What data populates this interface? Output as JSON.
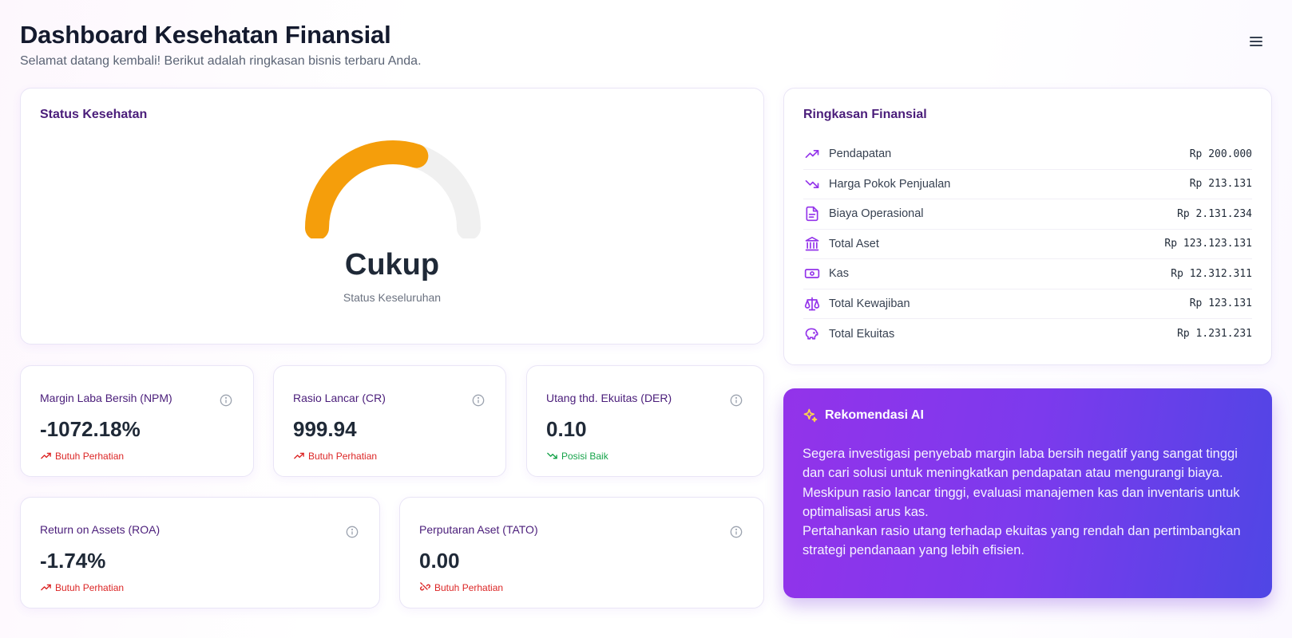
{
  "header": {
    "title": "Dashboard Kesehatan Finansial",
    "subtitle": "Selamat datang kembali! Berikut adalah ringkasan bisnis terbaru Anda."
  },
  "status": {
    "title": "Status Kesehatan",
    "value": "Cukup",
    "label": "Status Keseluruhan",
    "gauge_level": 0.6,
    "gauge_color": "#f59e0b"
  },
  "summary": {
    "title": "Ringkasan Finansial",
    "items": [
      {
        "label": "Pendapatan",
        "value": "Rp 200.000",
        "icon": "trending-up-icon"
      },
      {
        "label": "Harga Pokok Penjualan",
        "value": "Rp 213.131",
        "icon": "trending-down-icon"
      },
      {
        "label": "Biaya Operasional",
        "value": "Rp 2.131.234",
        "icon": "document-icon"
      },
      {
        "label": "Total Aset",
        "value": "Rp 123.123.131",
        "icon": "bank-icon"
      },
      {
        "label": "Kas",
        "value": "Rp 12.312.311",
        "icon": "cash-icon"
      },
      {
        "label": "Total Kewajiban",
        "value": "Rp 123.131",
        "icon": "scale-icon"
      },
      {
        "label": "Total Ekuitas",
        "value": "Rp 1.231.231",
        "icon": "piggy-bank-icon"
      }
    ]
  },
  "metrics": [
    {
      "label": "Margin Laba Bersih (NPM)",
      "value": "-1072.18%",
      "status": "Butuh Perhatian",
      "tone": "bad"
    },
    {
      "label": "Rasio Lancar (CR)",
      "value": "999.94",
      "status": "Butuh Perhatian",
      "tone": "bad"
    },
    {
      "label": "Utang thd. Ekuitas (DER)",
      "value": "0.10",
      "status": "Posisi Baik",
      "tone": "good"
    },
    {
      "label": "Return on Assets (ROA)",
      "value": "-1.74%",
      "status": "Butuh Perhatian",
      "tone": "bad"
    },
    {
      "label": "Perputaran Aset (TATO)",
      "value": "0.00",
      "status": "Butuh Perhatian",
      "tone": "bad"
    }
  ],
  "ai": {
    "title": "Rekomendasi AI",
    "lines": [
      "Segera investigasi penyebab margin laba bersih negatif yang sangat tinggi dan cari solusi untuk meningkatkan pendapatan atau mengurangi biaya.",
      "Meskipun rasio lancar tinggi, evaluasi manajemen kas dan inventaris untuk optimalisasi arus kas.",
      "Pertahankan rasio utang terhadap ekuitas yang rendah dan pertimbangkan strategi pendanaan yang lebih efisien."
    ]
  },
  "colors": {
    "accent": "#7c3aed",
    "label_purple": "#4a1d7a",
    "bad": "#dc2626",
    "good": "#16a34a"
  }
}
